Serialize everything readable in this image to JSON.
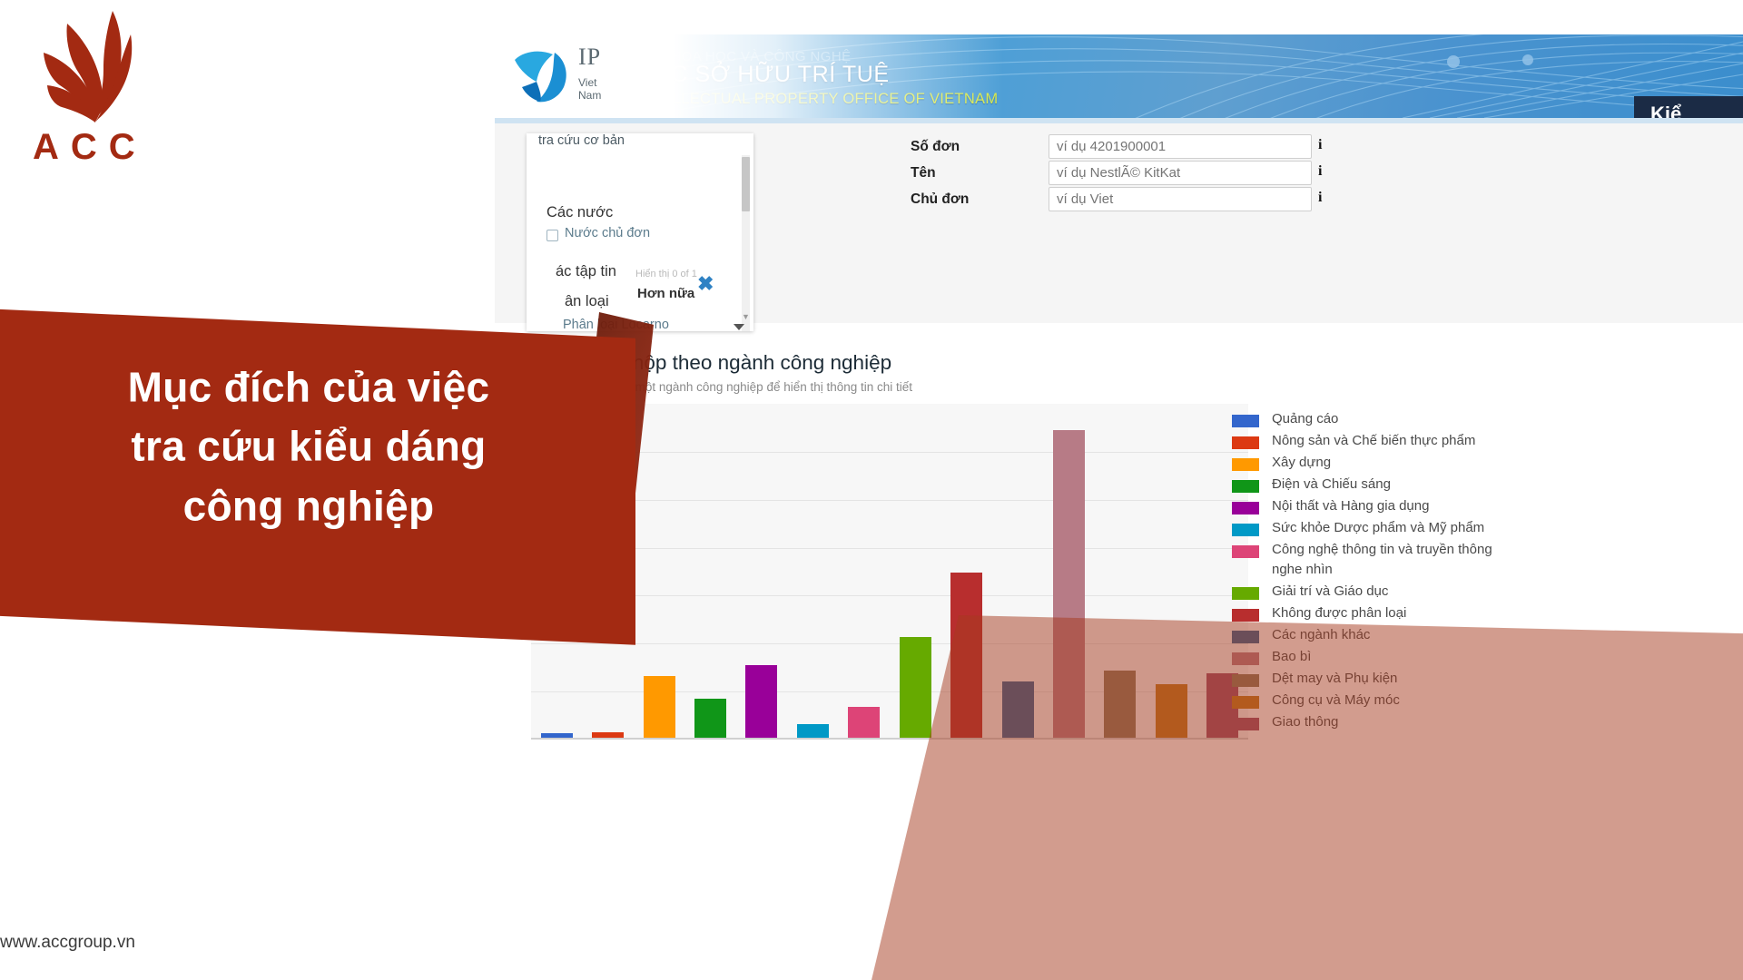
{
  "brand": {
    "name": "ACC",
    "logo_icon": "flame-icon",
    "color": "#A32A12"
  },
  "overlay": {
    "headline_lines": [
      "Mục đích của việc",
      "tra cứu kiểu dáng",
      "công nghiệp"
    ],
    "background_color": "#A32A12"
  },
  "footer": {
    "url": "www.accgroup.vn"
  },
  "site": {
    "logo_letters": "IP",
    "logo_sub": "Viet Nam",
    "ministry": "BỘ KHOA HỌC VÀ CÔNG NGHỆ",
    "office_vi": "CỤC SỞ HỮU TRÍ TUỆ",
    "office_en": "INTELLECTUAL PROPERTY OFFICE OF VIETNAM",
    "nav_tab": "Kiể",
    "accent_blue": "#2e8fd0",
    "accent_yellow": "#d7e84a"
  },
  "filter_panel": {
    "tab_label": "tra cứu cơ bản",
    "close_label": "✖",
    "groups": [
      {
        "title": "Các nước",
        "option": "Nước chủ đơn",
        "count": ""
      },
      {
        "title": "ác tập tin",
        "option": "",
        "count": "Hiển thị 0 of 1"
      },
      {
        "title": "ân loại",
        "option": "",
        "count": ""
      }
    ],
    "more_label": "Hơn nữa",
    "locarno_label": "Phân loại Locarno"
  },
  "search_form": {
    "fields": [
      {
        "label": "Số đơn",
        "value": "",
        "placeholder": "ví dụ 4201900001",
        "info": "i"
      },
      {
        "label": "Tên",
        "value": "",
        "placeholder": "ví dụ NestlÃ© KitKat",
        "info": "i"
      },
      {
        "label": "Chủ đơn",
        "value": "",
        "placeholder": "ví dụ Viet",
        "info": "i"
      }
    ]
  },
  "chart_panel": {
    "title": "kiểu dáng nộp theo ngành công nghiệp",
    "subtitle": "ể nháy chuột vào một ngành công nghiệp để hiển thị thông tin chi tiết"
  },
  "chart_data": {
    "type": "bar",
    "title": "kiểu dáng nộp theo ngành công nghiệp",
    "subtitle": "ể nháy chuột vào một ngành công nghiệp để hiển thị thông tin chi tiết",
    "xlabel": "",
    "ylabel": "",
    "grid": true,
    "legend_position": "right",
    "categories": [
      "Quảng cáo",
      "Nông sản và Chế biến thực phẩm",
      "Xây dựng",
      "Điện và Chiếu sáng",
      "Nội thất và Hàng gia dụng",
      "Sức khỏe Dược phẩm và Mỹ phẩm",
      "Công nghệ thông tin và truyền thông nghe nhìn",
      "Giải trí và Giáo dục",
      "Không được phân loại",
      "Các ngành khác",
      "Bao bì",
      "Dệt may và Phụ kiện",
      "Công cụ và Máy móc",
      "Giao thông"
    ],
    "colors": [
      "#3366CC",
      "#DC3912",
      "#FF9900",
      "#109618",
      "#990099",
      "#0099C6",
      "#DD4477",
      "#66AA00",
      "#B82E2E",
      "#316395",
      "#B77B86",
      "#8C7B5E",
      "#C07A1E",
      "#9E4F6B"
    ],
    "values": [
      3,
      4,
      44,
      28,
      52,
      10,
      22,
      72,
      118,
      40,
      220,
      48,
      38,
      46
    ],
    "ylim": [
      0,
      240
    ]
  }
}
